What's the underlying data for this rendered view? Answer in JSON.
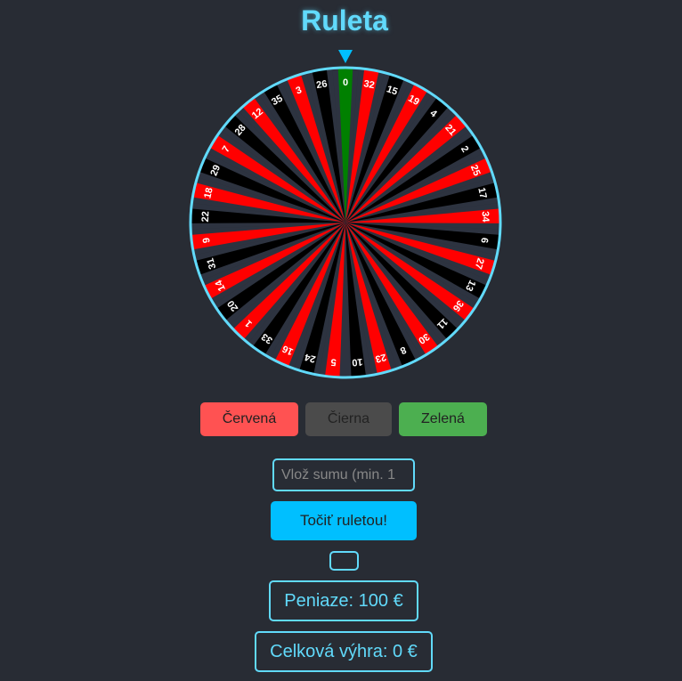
{
  "title": "Ruleta",
  "wheel": {
    "numbers": [
      0,
      32,
      15,
      19,
      4,
      21,
      2,
      25,
      17,
      34,
      6,
      27,
      13,
      36,
      11,
      30,
      8,
      23,
      10,
      5,
      24,
      16,
      33,
      1,
      20,
      14,
      31,
      9,
      22,
      18,
      29,
      7,
      28,
      12,
      35,
      3,
      26
    ],
    "red_numbers": [
      32,
      19,
      21,
      25,
      34,
      27,
      36,
      30,
      23,
      5,
      16,
      1,
      14,
      9,
      18,
      7,
      12,
      3
    ],
    "colors": {
      "red": "#ff0000",
      "black": "#000000",
      "green": "#008000",
      "rim": "#61dafb",
      "divider": "#2d3340",
      "label": "#ffffff"
    },
    "pointer_icon": "triangle-down-icon",
    "pointer_color": "#00bfff"
  },
  "bet_buttons": {
    "red_label": "Červená",
    "black_label": "Čierna",
    "green_label": "Zelená"
  },
  "bet_input": {
    "placeholder": "Vlož sumu (min. 1",
    "value": ""
  },
  "spin_button_label": "Točiť ruletou!",
  "result_text": "",
  "money_text": "Peniaze: 100 €",
  "winnings_text": "Celková výhra: 0 €"
}
